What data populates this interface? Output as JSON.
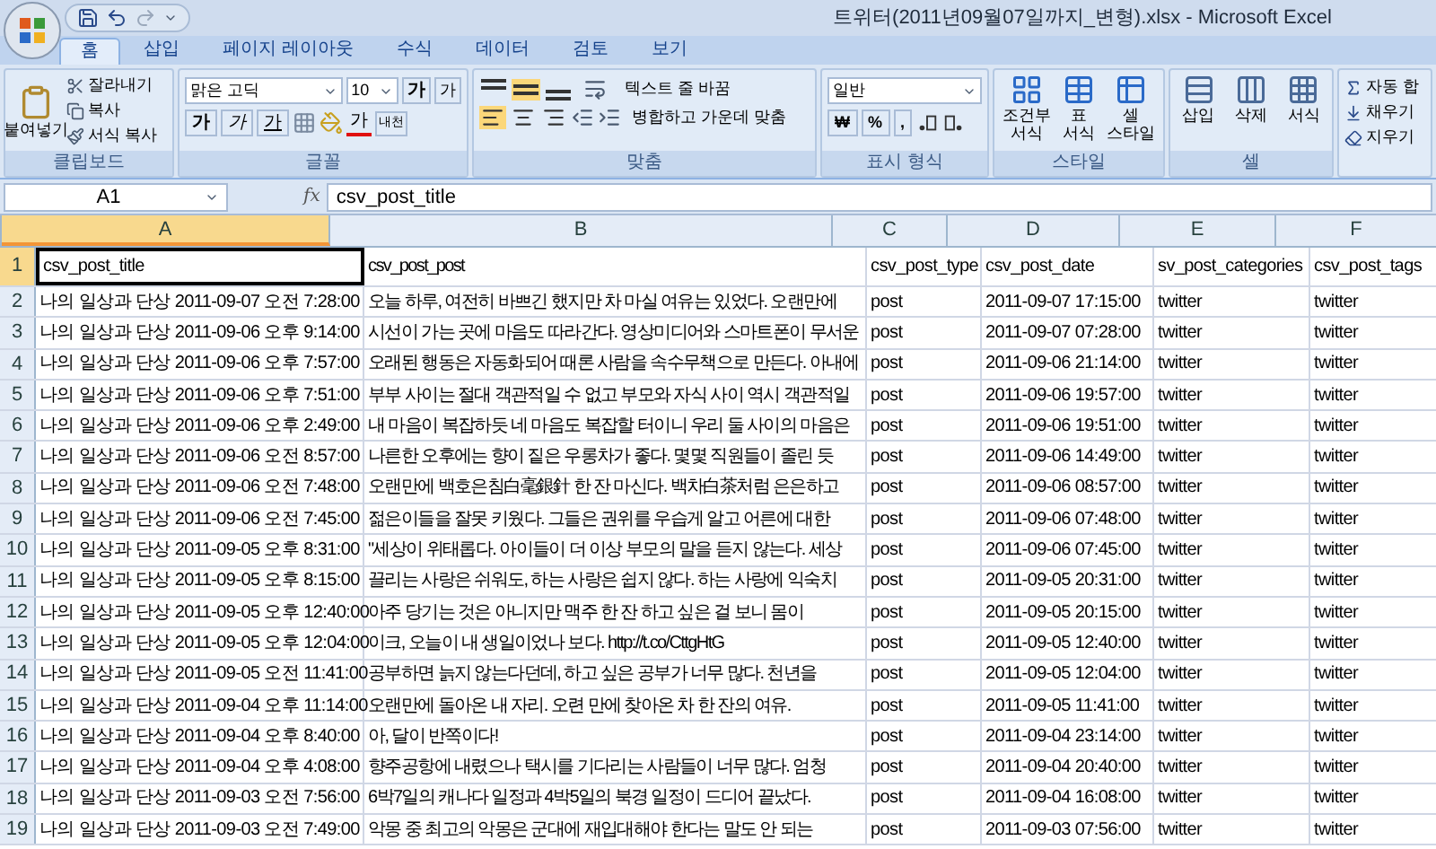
{
  "window": {
    "title": "트위터(2011년09월07일까지_변형).xlsx - Microsoft Excel"
  },
  "tabs": [
    {
      "label": "홈",
      "selected": true
    },
    {
      "label": "삽입",
      "selected": false
    },
    {
      "label": "페이지 레이아웃",
      "selected": false
    },
    {
      "label": "수식",
      "selected": false
    },
    {
      "label": "데이터",
      "selected": false
    },
    {
      "label": "검토",
      "selected": false
    },
    {
      "label": "보기",
      "selected": false
    }
  ],
  "ribbon": {
    "clipboard": {
      "label": "클립보드",
      "paste": "붙여넣기",
      "items": [
        "잘라내기",
        "복사",
        "서식 복사"
      ]
    },
    "font": {
      "label": "글꼴",
      "name": "맑은 고딕",
      "size": "10",
      "grow": "가",
      "shrink": "가",
      "styles": [
        {
          "label": "가",
          "kind": "bold"
        },
        {
          "label": "가",
          "kind": "italic"
        },
        {
          "label": "가",
          "kind": "underline"
        }
      ],
      "color_glyph": "가",
      "phonetic": "내천"
    },
    "alignment": {
      "label": "맞춤",
      "vertical": [
        {
          "selected": false
        },
        {
          "selected": true
        },
        {
          "selected": false
        }
      ],
      "horizontal": [
        {
          "selected": true
        },
        {
          "selected": false
        },
        {
          "selected": false
        }
      ],
      "wrap": "텍스트 줄 바꿈",
      "merge": "병합하고 가운데 맞춤"
    },
    "number": {
      "label": "표시 형식",
      "format": "일반",
      "buttons": [
        "₩",
        "%",
        ","
      ]
    },
    "styles": {
      "label": "스타일",
      "items": [
        [
          "조건부",
          "서식"
        ],
        [
          "표",
          "서식"
        ],
        [
          "셀",
          "스타일"
        ]
      ]
    },
    "cells": {
      "label": "셀",
      "items": [
        "삽입",
        "삭제",
        "서식"
      ]
    },
    "editing": {
      "items": [
        "자동 합",
        "채우기",
        "지우기"
      ]
    }
  },
  "formula_bar": {
    "name_box": "A1",
    "fx": "fx",
    "value": "csv_post_title"
  },
  "sheet": {
    "columns": [
      {
        "label": "A",
        "selected": true
      },
      {
        "label": "B",
        "selected": false
      },
      {
        "label": "C",
        "selected": false
      },
      {
        "label": "D",
        "selected": false
      },
      {
        "label": "E",
        "selected": false
      },
      {
        "label": "F",
        "selected": false
      }
    ],
    "rows": [
      {
        "number": "1",
        "selected": true,
        "cells": [
          "csv_post_title",
          "csv_post_post",
          "csv_post_type",
          "csv_post_date",
          "sv_post_categories",
          "csv_post_tags"
        ]
      },
      {
        "number": "2",
        "selected": false,
        "cells": [
          "나의 일상과 단상 2011-09-07 오전 7:28:00",
          "오늘 하루, 여전히 바쁘긴 했지만 차 마실 여유는 있었다. 오랜만에",
          "post",
          "2011-09-07 17:15:00",
          "twitter",
          "twitter"
        ]
      },
      {
        "number": "3",
        "selected": false,
        "cells": [
          "나의 일상과 단상 2011-09-06 오후 9:14:00",
          "시선이 가는 곳에 마음도 따라간다. 영상미디어와 스마트폰이 무서운",
          "post",
          "2011-09-07 07:28:00",
          "twitter",
          "twitter"
        ]
      },
      {
        "number": "4",
        "selected": false,
        "cells": [
          "나의 일상과 단상 2011-09-06 오후 7:57:00",
          "오래된 행동은 자동화되어 때론 사람을 속수무책으로 만든다. 아내에",
          "post",
          "2011-09-06 21:14:00",
          "twitter",
          "twitter"
        ]
      },
      {
        "number": "5",
        "selected": false,
        "cells": [
          "나의 일상과 단상 2011-09-06 오후 7:51:00",
          "부부 사이는 절대 객관적일 수 없고 부모와 자식 사이 역시 객관적일",
          "post",
          "2011-09-06 19:57:00",
          "twitter",
          "twitter"
        ]
      },
      {
        "number": "6",
        "selected": false,
        "cells": [
          "나의 일상과 단상 2011-09-06 오후 2:49:00",
          "내 마음이 복잡하듯 네 마음도 복잡할 터이니 우리 둘 사이의 마음은",
          "post",
          "2011-09-06 19:51:00",
          "twitter",
          "twitter"
        ]
      },
      {
        "number": "7",
        "selected": false,
        "cells": [
          "나의 일상과 단상 2011-09-06 오전 8:57:00",
          "나른한 오후에는 향이 짙은 우롱차가 좋다. 몇몇 직원들이 졸린 듯",
          "post",
          "2011-09-06 14:49:00",
          "twitter",
          "twitter"
        ]
      },
      {
        "number": "8",
        "selected": false,
        "cells": [
          "나의 일상과 단상 2011-09-06 오전 7:48:00",
          "오랜만에 백호은침白毫銀針 한 잔 마신다. 백차白茶처럼 은은하고",
          "post",
          "2011-09-06 08:57:00",
          "twitter",
          "twitter"
        ]
      },
      {
        "number": "9",
        "selected": false,
        "cells": [
          "나의 일상과 단상 2011-09-06 오전 7:45:00",
          "젊은이들을 잘못 키웠다. 그들은 권위를 우습게 알고 어른에 대한",
          "post",
          "2011-09-06 07:48:00",
          "twitter",
          "twitter"
        ]
      },
      {
        "number": "10",
        "selected": false,
        "cells": [
          "나의 일상과 단상 2011-09-05 오후 8:31:00",
          "\"세상이 위태롭다. 아이들이 더 이상 부모의 말을 듣지 않는다. 세상",
          "post",
          "2011-09-06 07:45:00",
          "twitter",
          "twitter"
        ]
      },
      {
        "number": "11",
        "selected": false,
        "cells": [
          "나의 일상과 단상 2011-09-05 오후 8:15:00",
          "끌리는 사랑은 쉬워도, 하는 사랑은 쉽지 않다. 하는 사랑에 익숙치",
          "post",
          "2011-09-05 20:31:00",
          "twitter",
          "twitter"
        ]
      },
      {
        "number": "12",
        "selected": false,
        "cells": [
          "나의 일상과 단상 2011-09-05 오후 12:40:00",
          "아주 당기는 것은 아니지만 맥주 한 잔 하고 싶은 걸 보니 몸이",
          "post",
          "2011-09-05 20:15:00",
          "twitter",
          "twitter"
        ]
      },
      {
        "number": "13",
        "selected": false,
        "cells": [
          "나의 일상과 단상 2011-09-05 오후 12:04:00",
          "이크, 오늘이 내 생일이었나 보다. http://t.co/CttgHtG",
          "post",
          "2011-09-05 12:40:00",
          "twitter",
          "twitter"
        ]
      },
      {
        "number": "14",
        "selected": false,
        "cells": [
          "나의 일상과 단상 2011-09-05 오전 11:41:00",
          "공부하면 늙지 않는다던데, 하고 싶은 공부가 너무 많다. 천년을",
          "post",
          "2011-09-05 12:04:00",
          "twitter",
          "twitter"
        ]
      },
      {
        "number": "15",
        "selected": false,
        "cells": [
          "나의 일상과 단상 2011-09-04 오후 11:14:00",
          "오랜만에 돌아온 내 자리. 오련 만에 찾아온 차 한 잔의 여유.",
          "post",
          "2011-09-05 11:41:00",
          "twitter",
          "twitter"
        ]
      },
      {
        "number": "16",
        "selected": false,
        "cells": [
          "나의 일상과 단상 2011-09-04 오후 8:40:00",
          "아, 달이 반쪽이다!",
          "post",
          "2011-09-04 23:14:00",
          "twitter",
          "twitter"
        ]
      },
      {
        "number": "17",
        "selected": false,
        "cells": [
          "나의 일상과 단상 2011-09-04 오후 4:08:00",
          "향주공항에 내렸으나 택시를 기다리는 사람들이 너무 많다. 엄청",
          "post",
          "2011-09-04 20:40:00",
          "twitter",
          "twitter"
        ]
      },
      {
        "number": "18",
        "selected": false,
        "cells": [
          "나의 일상과 단상 2011-09-03 오전 7:56:00",
          "6박7일의 캐나다 일정과 4박5일의 북경 일정이 드디어 끝났다.",
          "post",
          "2011-09-04 16:08:00",
          "twitter",
          "twitter"
        ]
      },
      {
        "number": "19",
        "selected": false,
        "cells": [
          "나의 일상과 단상 2011-09-03 오전 7:49:00",
          "악몽 중 최고의 악몽은 군대에 재입대해야 한다는 말도 안 되는",
          "post",
          "2011-09-03 07:56:00",
          "twitter",
          "twitter"
        ]
      }
    ]
  }
}
